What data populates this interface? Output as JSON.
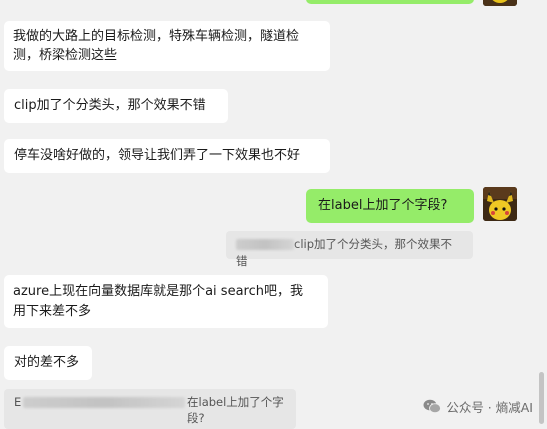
{
  "messages": {
    "m1": "我做的大路上的目标检测，特殊车辆检测，隧道检\n测，桥梁检测这些",
    "m2": "clip加了个分类头，那个效果不错",
    "m3": "停车没啥好做的，领导让我们弄了一下效果也不好",
    "m4_me": "在label上加了个字段?",
    "m5": "azure上现在向量数据库就是那个ai search吧，我\n用下来差不多",
    "m6": "对的差不多"
  },
  "quotes": {
    "q1_text": "clip加了个分类头，那个效果不错",
    "q2_prefix": "E",
    "q2_text": "在label上加了个字\n段?"
  },
  "watermark": {
    "text": "公众号 · 熵减AI",
    "icon": "wechat-icon"
  },
  "colors": {
    "my_bubble": "#95ec69",
    "their_bubble": "#ffffff",
    "background": "#f1f1f1"
  }
}
